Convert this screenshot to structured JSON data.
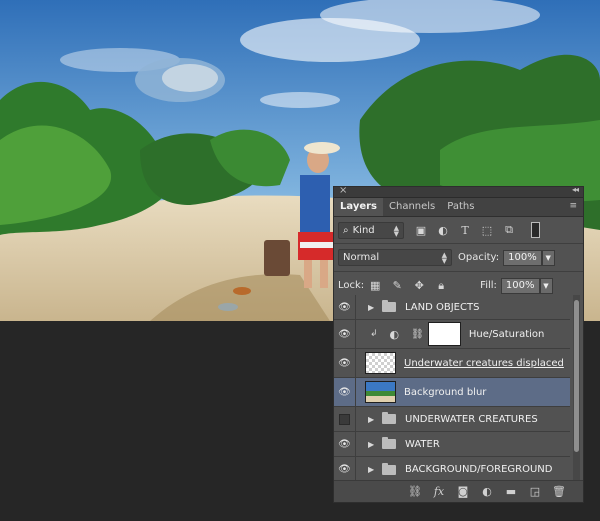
{
  "panel": {
    "close_glyph": "×",
    "collapse_glyph": "◂◂",
    "tabs": [
      {
        "label": "Layers"
      },
      {
        "label": "Channels"
      },
      {
        "label": "Paths"
      }
    ],
    "menu_glyph": "≡",
    "filter": {
      "label": "Kind",
      "search_icon": "search-icon"
    },
    "filter_icons": [
      "image-filter-icon",
      "adjustment-filter-icon",
      "type-filter-icon",
      "shape-filter-icon",
      "smart-object-filter-icon",
      "filter-toggle-icon"
    ],
    "blend_mode": "Normal",
    "opacity_label": "Opacity:",
    "opacity_value": "100%",
    "lock_label": "Lock:",
    "fill_label": "Fill:",
    "fill_value": "100%",
    "layers": [
      {
        "name": "LAND OBJECTS",
        "type": "group",
        "visible": true
      },
      {
        "name": "Hue/Saturation",
        "type": "adjustment",
        "visible": true
      },
      {
        "name": "Underwater creatures displaced",
        "type": "pixel",
        "visible": true
      },
      {
        "name": "Background blur",
        "type": "pixel",
        "visible": true,
        "selected": true
      },
      {
        "name": "UNDERWATER CREATURES",
        "type": "group",
        "visible": false
      },
      {
        "name": "WATER",
        "type": "group",
        "visible": true
      },
      {
        "name": "BACKGROUND/FOREGROUND",
        "type": "group",
        "visible": true
      }
    ],
    "footer_icons": [
      "link-layers-icon",
      "fx-icon",
      "add-mask-icon",
      "new-adjustment-icon",
      "new-group-icon",
      "new-layer-icon",
      "trash-icon"
    ],
    "fx_label": "fx"
  },
  "colors": {
    "panel_bg": "#525252",
    "selected_layer": "#5d6c87",
    "canvas_bg": "#262626"
  }
}
